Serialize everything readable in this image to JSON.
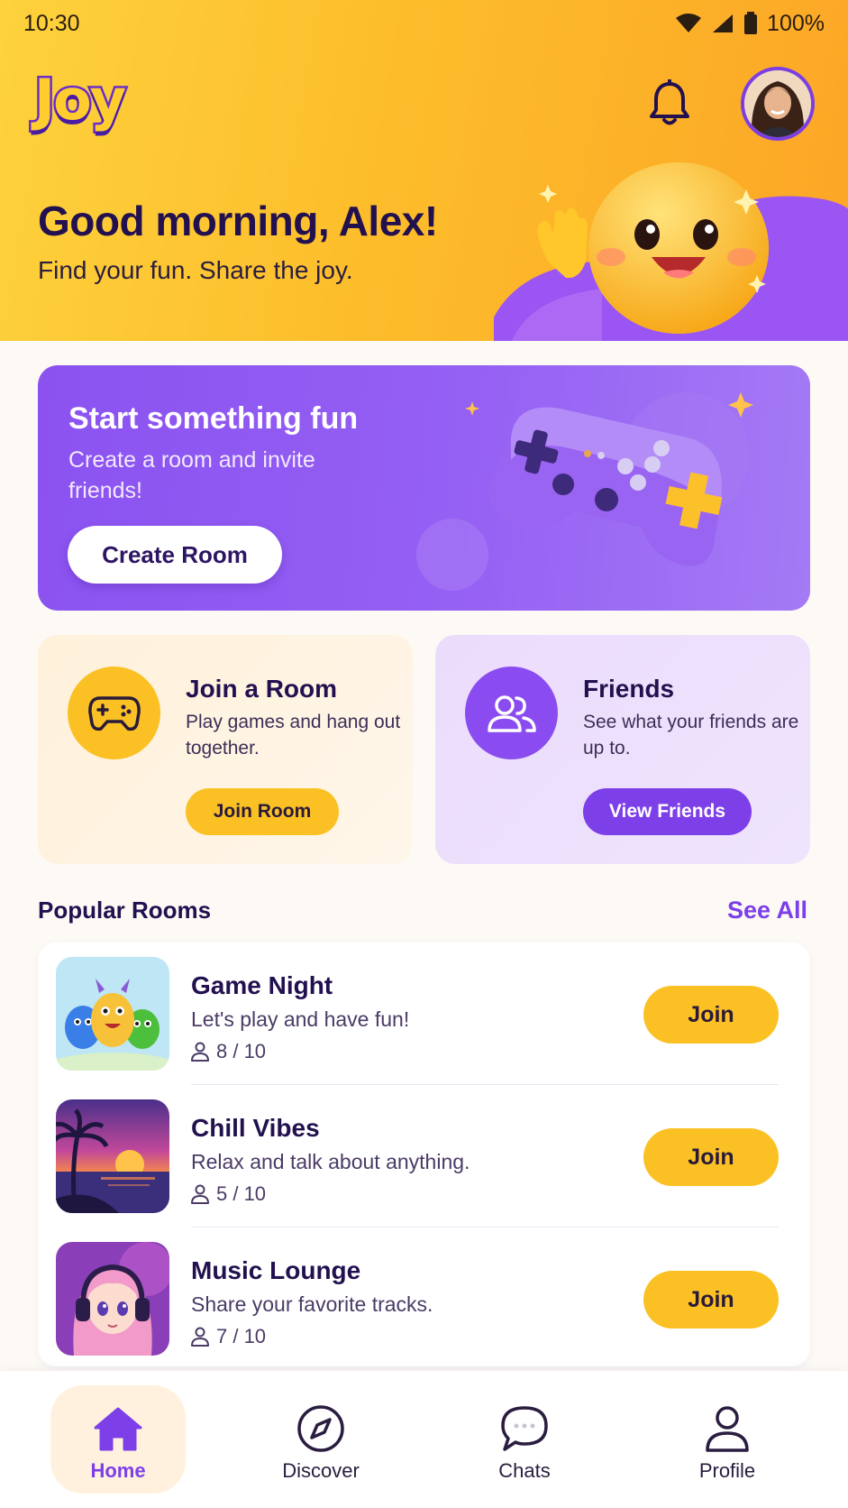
{
  "status_bar": {
    "time": "10:30",
    "battery": "100%"
  },
  "header": {
    "logo": "Joy",
    "greeting": "Good morning, Alex!",
    "tagline": "Find your fun. Share the joy."
  },
  "create_card": {
    "title": "Start something fun",
    "subtitle": "Create a room and invite friends!",
    "button": "Create Room"
  },
  "action_cards": {
    "join": {
      "title": "Join a Room",
      "description": "Play games and hang out together.",
      "button": "Join Room"
    },
    "friends": {
      "title": "Friends",
      "description": "See what your friends are up to.",
      "button": "View Friends"
    }
  },
  "popular_rooms": {
    "title": "Popular Rooms",
    "see_all": "See All",
    "rooms": [
      {
        "name": "Game Night",
        "description": "Let's play and have fun!",
        "count": "8 / 10",
        "button": "Join"
      },
      {
        "name": "Chill Vibes",
        "description": "Relax and talk about anything.",
        "count": "5 / 10",
        "button": "Join"
      },
      {
        "name": "Music Lounge",
        "description": "Share your favorite tracks.",
        "count": "7 / 10",
        "button": "Join"
      }
    ]
  },
  "bottom_nav": {
    "items": [
      {
        "label": "Home",
        "icon": "home-icon",
        "active": true
      },
      {
        "label": "Discover",
        "icon": "compass-icon",
        "active": false
      },
      {
        "label": "Chats",
        "icon": "chat-bubble-icon",
        "active": false
      },
      {
        "label": "Profile",
        "icon": "person-icon",
        "active": false
      }
    ]
  },
  "colors": {
    "primary_purple": "#7c3fe8",
    "accent_yellow": "#fbc124",
    "heading_navy": "#22104f"
  }
}
